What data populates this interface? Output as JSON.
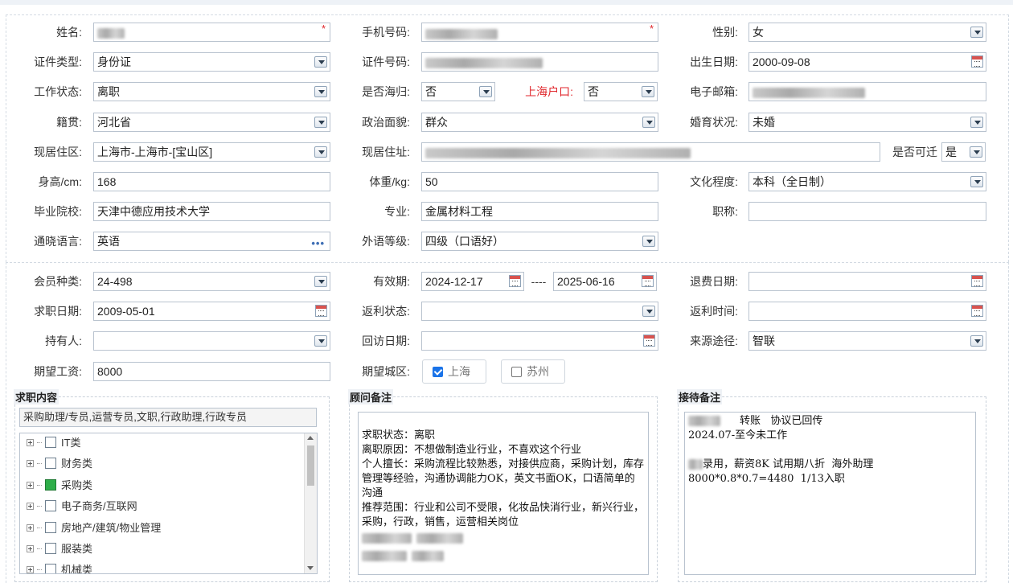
{
  "personal": {
    "name": {
      "label": "姓名:",
      "value": "██",
      "required": "*"
    },
    "mobile": {
      "label": "手机号码:",
      "value": "███ ████",
      "required": "*"
    },
    "gender": {
      "label": "性别:",
      "value": "女"
    },
    "id_type": {
      "label": "证件类型:",
      "value": "身份证"
    },
    "id_number": {
      "label": "证件号码:",
      "value": "████████████████"
    },
    "birth_date": {
      "label": "出生日期:",
      "value": "2000-09-08"
    },
    "work_status": {
      "label": "工作状态:",
      "value": "离职"
    },
    "returnee": {
      "label": "是否海归:",
      "value": "否"
    },
    "shanghai_hukou": {
      "label": "上海户口:",
      "value": "否"
    },
    "email": {
      "label": "电子邮箱:",
      "value": "████████@██████"
    },
    "native_place": {
      "label": "籍贯:",
      "value": "河北省"
    },
    "political": {
      "label": "政治面貌:",
      "value": "群众"
    },
    "marital": {
      "label": "婚育状况:",
      "value": "未婚"
    },
    "residence_area": {
      "label": "现居住区:",
      "value": "上海市-上海市-[宝山区]"
    },
    "residence_address": {
      "label": "现居住址:",
      "value": "████ ██████ ██████ ████"
    },
    "relocatable": {
      "label": "是否可迁",
      "value": "是"
    },
    "height": {
      "label": "身高/cm:",
      "value": "168"
    },
    "weight": {
      "label": "体重/kg:",
      "value": "50"
    },
    "education": {
      "label": "文化程度:",
      "value": "本科（全日制）"
    },
    "school": {
      "label": "毕业院校:",
      "value": "天津中德应用技术大学"
    },
    "major": {
      "label": "专业:",
      "value": "金属材料工程"
    },
    "title": {
      "label": "职称:",
      "value": ""
    },
    "languages": {
      "label": "通晓语言:",
      "value": "英语"
    },
    "language_level": {
      "label": "外语等级:",
      "value": "四级（口语好）"
    }
  },
  "membership": {
    "type": {
      "label": "会员种类:",
      "value": "24-498"
    },
    "valid": {
      "label": "有效期:",
      "start": "2024-12-17",
      "sep": "----",
      "end": "2025-06-16"
    },
    "refund_date": {
      "label": "退费日期:",
      "value": ""
    },
    "job_date": {
      "label": "求职日期:",
      "value": "2009-05-01"
    },
    "rebate_status": {
      "label": "返利状态:",
      "value": ""
    },
    "rebate_time": {
      "label": "返利时间:",
      "value": ""
    },
    "holder": {
      "label": "持有人:",
      "value": ""
    },
    "visit_date": {
      "label": "回访日期:",
      "value": ""
    },
    "source": {
      "label": "来源途径:",
      "value": "智联"
    },
    "salary": {
      "label": "期望工资:",
      "value": "8000"
    },
    "city": {
      "label": "期望城区:",
      "options": [
        {
          "label": "上海",
          "checked": true
        },
        {
          "label": "苏州",
          "checked": false
        }
      ]
    }
  },
  "job_content": {
    "legend": "求职内容",
    "selected": "采购助理/专员,运营专员,文职,行政助理,行政专员",
    "categories": [
      {
        "label": "IT类",
        "checked": false
      },
      {
        "label": "财务类",
        "checked": false
      },
      {
        "label": "采购类",
        "checked": true
      },
      {
        "label": "电子商务/互联网",
        "checked": false
      },
      {
        "label": "房地产/建筑/物业管理",
        "checked": false
      },
      {
        "label": "服装类",
        "checked": false
      },
      {
        "label": "机械类",
        "checked": false
      }
    ]
  },
  "advisor_notes": {
    "legend": "顾问备注",
    "text": "求职状态：离职\n离职原因：不想做制造业行业，不喜欢这个行业\n个人擅长：采购流程比较熟悉，对接供应商，采购计划，库存管理等经验，沟通协调能力OK，英文书面OK，口语简单的沟通\n推荐范围：行业和公司不受限，化妆品快消行业，新兴行业，采购，行政，销售，运营相关岗位"
  },
  "reception_notes": {
    "legend": "接待备注",
    "line1": "转账   协议已回传",
    "line2": "2024.07-至今未工作",
    "line3": "录用，薪资8K 试用期八折  海外助理",
    "line4": "8000*0.8*0.7=4480  1/13入职"
  }
}
